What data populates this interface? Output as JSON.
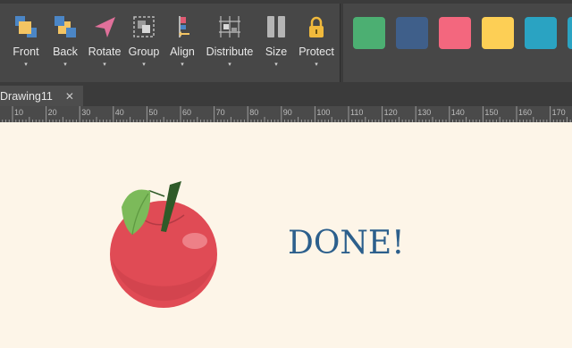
{
  "toolbar": {
    "tools": [
      {
        "label": "Front",
        "icon": "bring-to-front-icon"
      },
      {
        "label": "Back",
        "icon": "send-to-back-icon"
      },
      {
        "label": "Rotate",
        "icon": "rotate-icon"
      },
      {
        "label": "Group",
        "icon": "group-icon"
      },
      {
        "label": "Align",
        "icon": "align-icon"
      },
      {
        "label": "Distribute",
        "icon": "distribute-icon"
      },
      {
        "label": "Size",
        "icon": "size-icon"
      },
      {
        "label": "Protect",
        "icon": "lock-icon"
      }
    ],
    "dropdown_glyph": "▾"
  },
  "swatches": [
    "#4caf72",
    "#3f5f8a",
    "#f3677e",
    "#fdcf55",
    "#2aa3c2",
    "#2aa3c2"
  ],
  "tabs": {
    "active": "Drawing11",
    "close_glyph": "✕"
  },
  "ruler": {
    "labels": [
      "10",
      "20",
      "30",
      "40",
      "50",
      "60",
      "70",
      "80",
      "90",
      "100",
      "110",
      "120",
      "130",
      "140",
      "150",
      "160",
      "170"
    ]
  },
  "canvas": {
    "text": "DONE!",
    "text_color": "#2c5f8c",
    "apple": {
      "body_color": "#e04b55",
      "leaf_color": "#7cba5a",
      "stem_color": "#2f5a28"
    }
  }
}
